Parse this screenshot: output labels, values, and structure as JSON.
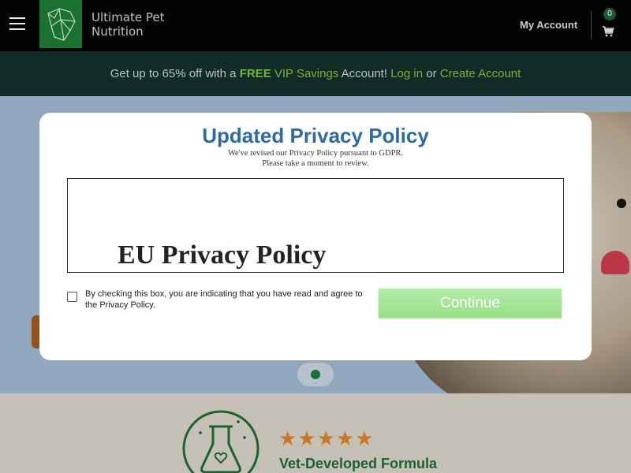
{
  "header": {
    "brand_line1": "Ultimate Pet",
    "brand_line2": "Nutrition",
    "my_account": "My Account",
    "cart_count": "0",
    "icons": [
      "menu-icon",
      "logo-icon",
      "cart-icon"
    ]
  },
  "promo": {
    "text_pre": "Get up to 65% off with a ",
    "free": "FREE",
    "vip": " VIP Savings",
    "text_mid": " Account! ",
    "login": "Log in",
    "or": " or ",
    "create": "Create Account"
  },
  "below_hero": {
    "stars": "★★★★★",
    "title": "Vet-Developed Formula"
  },
  "modal": {
    "title": "Updated Privacy Policy",
    "subtitle_line1": "We've revised our Privacy Policy pursuant to GDPR.",
    "subtitle_line2": "Please take a moment to review.",
    "policy_heading": "EU Privacy Policy",
    "agree_text": "By checking this box, you are indicating that you have read and agree to the Privacy Policy.",
    "continue_label": "Continue"
  },
  "colors": {
    "header_bg": "#050505",
    "logo_bg": "#1e7a34",
    "promo_bg": "#13302a",
    "promo_accent": "#7ec23b",
    "hero_bg": "#9db5cd",
    "modal_title": "#2e69a8",
    "continue_bg": "#a8e79b",
    "vet_green": "#1d6b34",
    "star_color": "#d9822b"
  }
}
